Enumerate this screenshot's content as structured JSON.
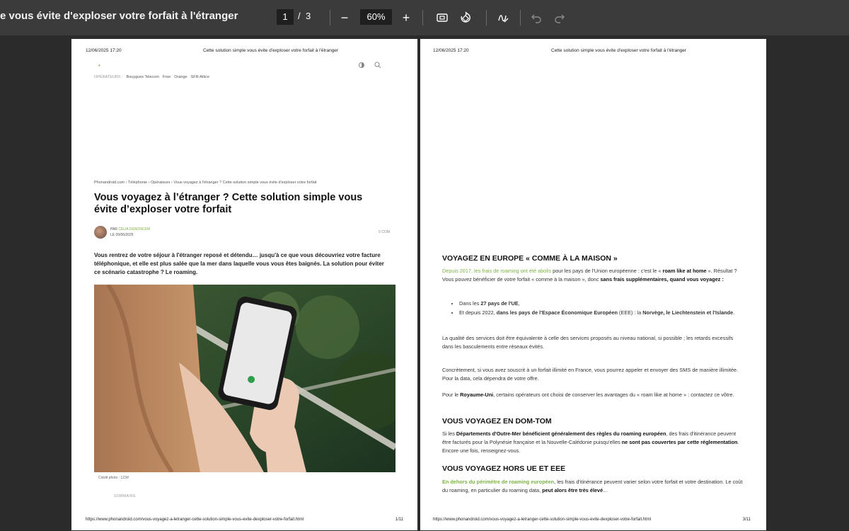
{
  "toolbar": {
    "doc_title": "e vous évite d'exploser votre forfait à l'étranger",
    "page_current": "1",
    "page_sep": "/",
    "page_total": "3",
    "zoom_out": "−",
    "zoom": "60%",
    "zoom_in": "+",
    "accent": "#3b3b3b"
  },
  "page1": {
    "header_date": "12/06/2025 17:20",
    "header_title": "Cette solution simple vous évite d'exploser votre forfait à l'étranger",
    "logo_dot": "•",
    "operators_label": "OPÉRATEURS :",
    "operators": [
      "Bouygues Telecom",
      "Free",
      "Orange",
      "SFR-Altice"
    ],
    "breadcrumb": "Phonandroid.com  ›  Téléphonie  ›  Opérateurs  ›  Vous voyagez à l'étranger ? Cette solution simple vous évite d'exploser votre forfait",
    "title": "Vous voyagez à l’étranger ? Cette solution simple vous évite d’exploser votre forfait",
    "author_prefix": "PAR",
    "author_name": "CÉLIA DENONCEM",
    "author_date": "LE 09/06/2025",
    "comments": "0 COM",
    "intro": "Vous rentrez de votre séjour à l'étranger reposé et détendu… jusqu'à ce que vous découvriez votre facture téléphonique, et elle est plus salée que la mer dans laquelle vous vous êtes baignés. La solution pour éviter ce scénario catastrophe ? Le roaming.",
    "photo_credit": "Crédit photo : 123rf",
    "sommaire": "SOMMAIRE",
    "footer_url": "https://www.phonandroid.com/vous-voyagez-a-letranger-cette-solution-simple-vous-evite-dexploser-votre-forfait.html",
    "footer_page": "1/11"
  },
  "page2": {
    "header_date": "12/06/2025 17:20",
    "header_title": "Cette solution simple vous évite d'exploser votre forfait à l'étranger",
    "h_europe": "VOYAGEZ EN EUROPE « COMME À LA MAISON »",
    "europe_link": "Depuis 2017, les frais de roaming ont été abolis",
    "europe_p1a": " pour les pays de l'Union européenne : c'est le « ",
    "europe_p1b": "roam like at home",
    "europe_p1c": " ». Résultat ? Vous pouvez bénéficier de votre forfait « comme à la maison », donc ",
    "europe_p1d": "sans frais supplémentaires, quand vous voyagez :",
    "bullet1a": "Dans les ",
    "bullet1b": "27 pays de l'UE",
    "bullet1c": ",",
    "bullet2a": "Et depuis 2022, ",
    "bullet2b": "dans les pays de l'Espace Économique Européen",
    "bullet2c": " (EEE) : la ",
    "bullet2d": "Norvège, le Liechtenstein et l'Islande",
    "bullet2e": ".",
    "quality": "La qualité des services doit être équivalente à celle des services proposés au niveau national, si possible ; les retards excessifs dans les basculements entre réseaux évités.",
    "concretely": "Concrètement, si vous avez souscrit à un forfait illimité en France, vous pourrez appeler et envoyer des SMS de manière illimitée. Pour la data, cela dépendra de votre offre.",
    "uk_a": "Pour le ",
    "uk_b": "Royaume-Uni",
    "uk_c": ", certains opérateurs ont choisi de conserver les avantages du « roam like at home » : contactez ce vôtre.",
    "h_domtom": "VOUS VOYAGEZ EN DOM-TOM",
    "domtom_a": "Si les ",
    "domtom_b": "Départements d'Outre-Mer bénéficient généralement des règles du roaming européen",
    "domtom_c": ", des frais d'itinérance peuvent être facturés pour la Polynésie française et la Nouvelle-Calédonie puisqu'elles ",
    "domtom_d": "ne sont pas couvertes par cette réglementation",
    "domtom_e": ". Encore une fois, renseignez-vous.",
    "h_hors": "VOUS VOYAGEZ HORS UE ET EEE",
    "hors_link": "En dehors du périmètre de roaming européen",
    "hors_a": ", les frais d'itinérance peuvent varier selon votre forfait et votre destination. Le coût du roaming, en particulier du roaming data, ",
    "hors_b": "peut alors être très élevé",
    "hors_c": "…",
    "footer_url": "https://www.phonandroid.com/vous-voyagez-a-letranger-cette-solution-simple-vous-evite-dexploser-votre-forfait.html",
    "footer_page": "3/11"
  }
}
